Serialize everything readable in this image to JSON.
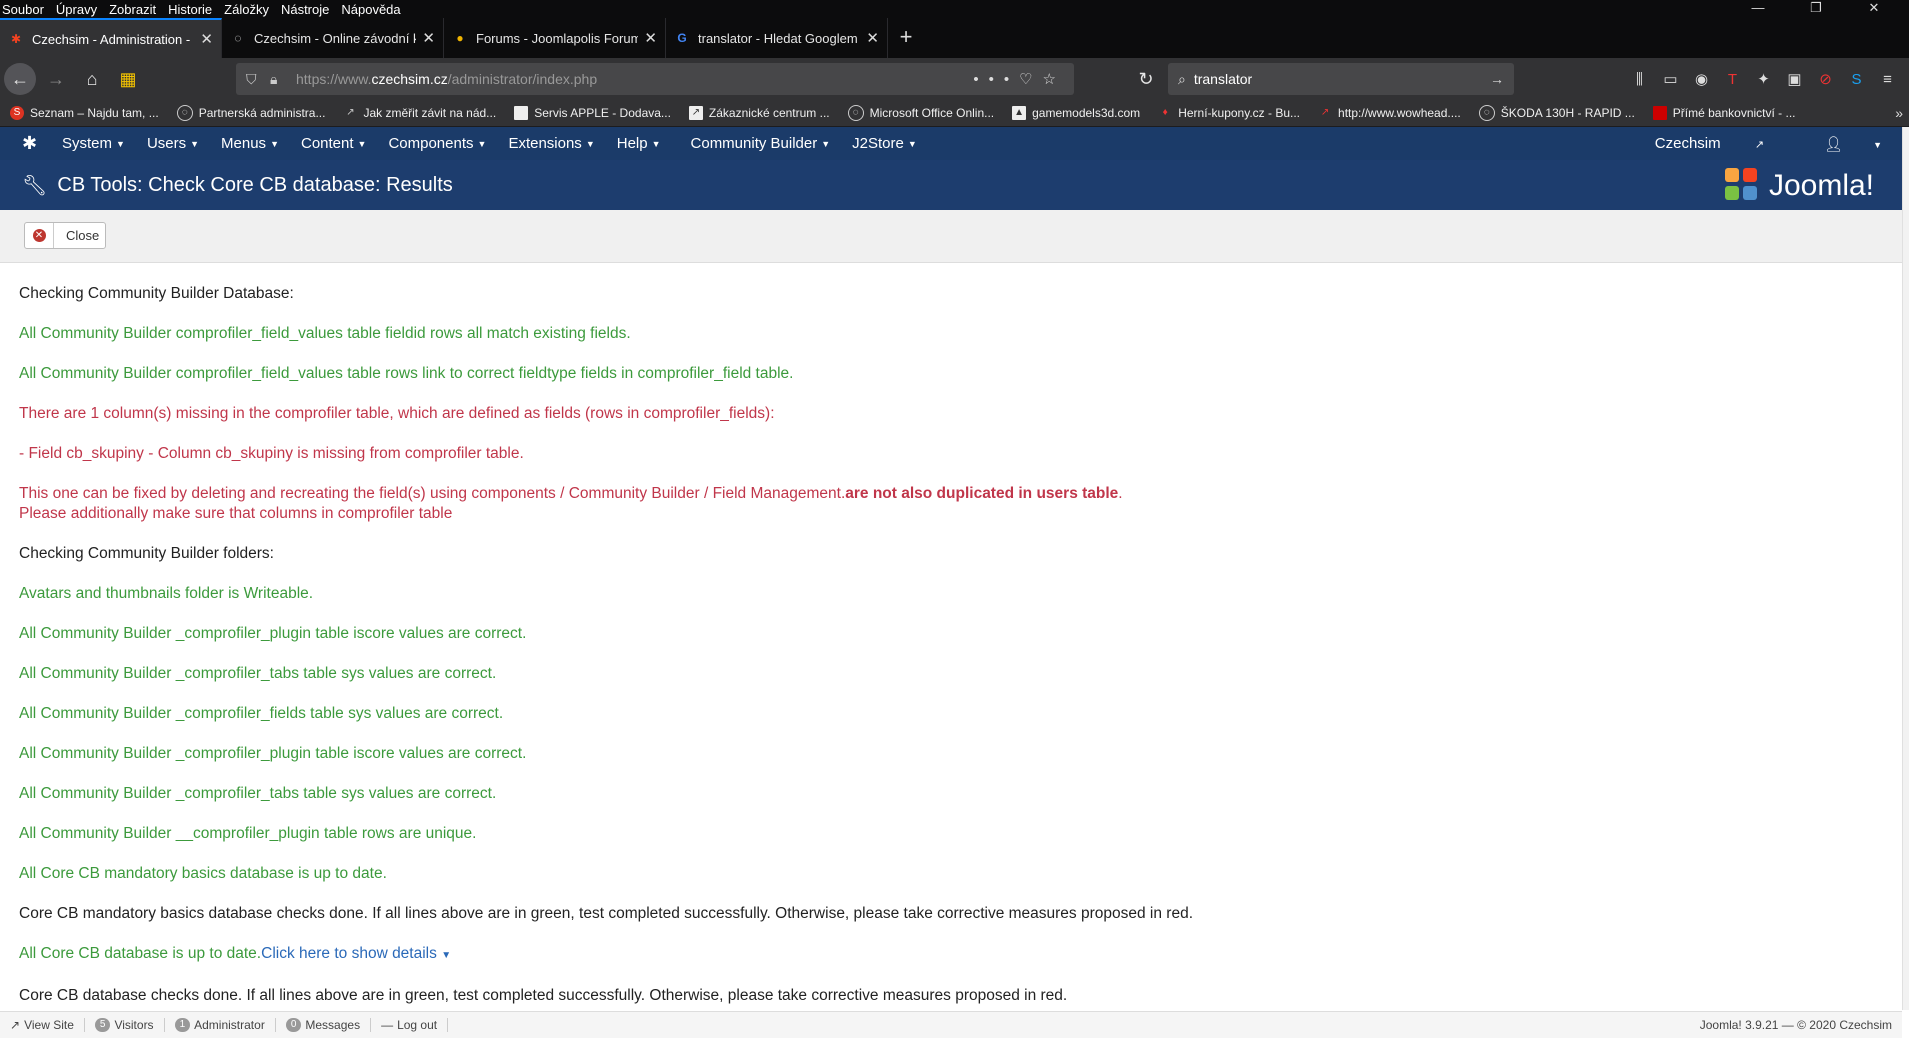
{
  "firefox_menu": [
    "Soubor",
    "Úpravy",
    "Zobrazit",
    "Historie",
    "Záložky",
    "Nástroje",
    "Nápověda"
  ],
  "tabs": [
    {
      "title": "Czechsim - Administration - Czechsim",
      "active": true
    },
    {
      "title": "Czechsim - Online závodní komunita",
      "active": false
    },
    {
      "title": "Forums - Joomlapolis Forum",
      "active": false
    },
    {
      "title": "translator - Hledat Googlem",
      "active": false
    }
  ],
  "url": {
    "prefix": "https://www.",
    "domain": "czechsim.cz",
    "path": "/administrator/index.php"
  },
  "search": {
    "value": "translator"
  },
  "bookmarks": [
    "Seznam – Najdu tam, ...",
    "Partnerská administra...",
    "Jak změřit závit na nád...",
    "Servis APPLE - Dodava...",
    "Zákaznické centrum ...",
    "Microsoft Office Onlin...",
    "gamemodels3d.com",
    "Herní-kupony.cz - Bu...",
    "http://www.wowhead....",
    "ŠKODA 130H - RAPID ...",
    "Přímé bankovnictví - ..."
  ],
  "admin_menu": [
    "System",
    "Users",
    "Menus",
    "Content",
    "Components",
    "Extensions",
    "Help",
    "Community Builder",
    "J2Store"
  ],
  "admin_right": {
    "site": "Czechsim"
  },
  "page_title": "CB Tools: Check Core CB database: Results",
  "joomla_logo": "Joomla!",
  "toolbar": {
    "close_label": "Close"
  },
  "results": {
    "l1": "Checking Community Builder Database:",
    "l2": "All Community Builder comprofiler_field_values table fieldid rows all match existing fields.",
    "l3": "All Community Builder comprofiler_field_values table rows link to correct fieldtype fields in comprofiler_field table.",
    "l4": "There are 1 column(s) missing in the comprofiler table, which are defined as fields (rows in comprofiler_fields):",
    "l5": "- Field cb_skupiny - Column cb_skupiny is missing from comprofiler table.",
    "l6a": "This one can be fixed by deleting and recreating the field(s) using components / Community Builder / Field Management.",
    "l6b": "are not also duplicated in users table",
    "l6c": ".",
    "l6d": "Please additionally make sure that columns in comprofiler table",
    "l7": "Checking Community Builder folders:",
    "l8": "Avatars and thumbnails folder is Writeable.",
    "l9": "All Community Builder _comprofiler_plugin table iscore values are correct.",
    "l10": "All Community Builder _comprofiler_tabs table sys values are correct.",
    "l11": "All Community Builder _comprofiler_fields table sys values are correct.",
    "l12": "All Community Builder _comprofiler_plugin table iscore values are correct.",
    "l13": "All Community Builder _comprofiler_tabs table sys values are correct.",
    "l14": "All Community Builder __comprofiler_plugin table rows are unique.",
    "l15": "All Core CB mandatory basics database is up to date.",
    "l16": "Core CB mandatory basics database checks done. If all lines above are in green, test completed successfully. Otherwise, please take corrective measures proposed in red.",
    "l17a": "All Core CB database is up to date.",
    "l17b": "Click here to show details",
    "l18": "Core CB database checks done. If all lines above are in green, test completed successfully. Otherwise, please take corrective measures proposed in red."
  },
  "footer": {
    "view_site": "View Site",
    "visitors_count": "5",
    "visitors": "Visitors",
    "admin_count": "1",
    "admin": "Administrator",
    "messages_count": "0",
    "messages": "Messages",
    "logout": "Log out",
    "version": "Joomla! 3.9.21 — © 2020 Czechsim"
  },
  "colors": {
    "admin_nav": "#1b3b69",
    "header": "#1d3d6e",
    "success": "#3c9a3c",
    "error": "#c0364a",
    "link": "#2a69b8"
  }
}
